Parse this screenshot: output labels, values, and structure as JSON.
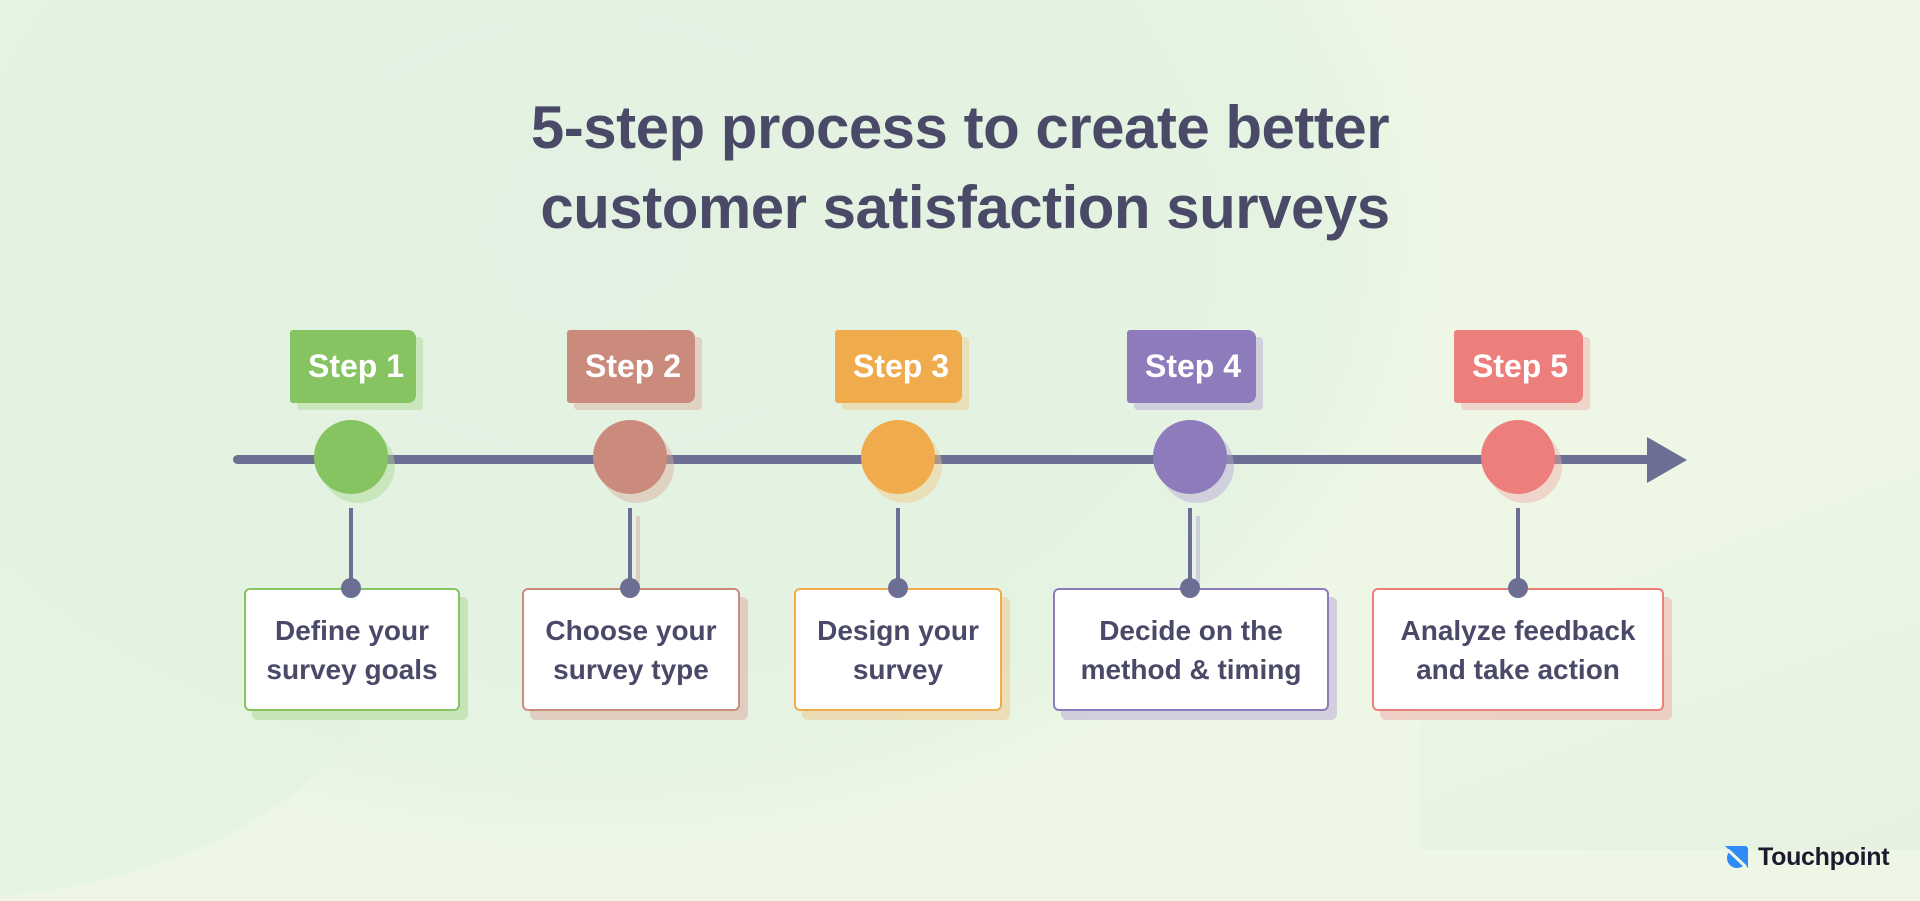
{
  "title": {
    "line1": "5-step process to create better",
    "line2": "customer satisfaction surveys"
  },
  "timeline": {
    "axis_color": "#6c6f93",
    "arrow_icon": "arrow-right-icon",
    "steps": [
      {
        "label": "Step 1",
        "desc_line1": "Define your",
        "desc_line2": "survey goals",
        "color": "#86c462",
        "shadow": "#a9d68f"
      },
      {
        "label": "Step 2",
        "desc_line1": "Choose your",
        "desc_line2": "survey type",
        "color": "#cb8b7c",
        "shadow": "#d9aa9d"
      },
      {
        "label": "Step 3",
        "desc_line1": "Design your",
        "desc_line2": "survey",
        "color": "#f0ab4c",
        "shadow": "#f0c888"
      },
      {
        "label": "Step 4",
        "desc_line1": "Decide on the",
        "desc_line2": "method & timing",
        "color": "#8e7bbc",
        "shadow": "#b3a7d4"
      },
      {
        "label": "Step 5",
        "desc_line1": "Analyze feedback",
        "desc_line2": "and take action",
        "color": "#ec7e7c",
        "shadow": "#eea9a6"
      }
    ]
  },
  "brand": {
    "name": "Touchpoint",
    "icon": "touchpoint-logo-icon",
    "color": "#2f8af5"
  }
}
